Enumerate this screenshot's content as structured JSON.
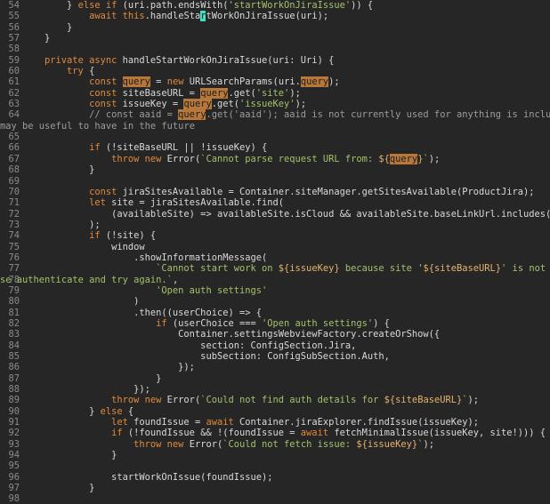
{
  "editor": {
    "language": "typescript",
    "colors": {
      "background": "#262626",
      "line_number": "#8b8b8b",
      "text": "#d9d9d9",
      "keyword": "#e08a3c",
      "string": "#a3c26a",
      "comment": "#9c9c9c",
      "search_highlight": "#b7783a",
      "cursor": "#3ce0c2"
    },
    "lines": [
      {
        "n": "54",
        "tokens": [
          {
            "t": "        } "
          },
          {
            "t": "else if",
            "c": "kw"
          },
          {
            "t": " (uri.path.endsWith("
          },
          {
            "t": "'startWorkOnJiraIssue'",
            "c": "str"
          },
          {
            "t": ")) {"
          }
        ]
      },
      {
        "n": "55",
        "tokens": [
          {
            "t": "            "
          },
          {
            "t": "await",
            "c": "kw"
          },
          {
            "t": " "
          },
          {
            "t": "this",
            "c": "kw"
          },
          {
            "t": ".handleSta"
          },
          {
            "t": "r",
            "c": "cur"
          },
          {
            "t": "tWorkOnJiraIssue(uri);"
          }
        ]
      },
      {
        "n": "56",
        "tokens": [
          {
            "t": "        }"
          }
        ]
      },
      {
        "n": "57",
        "tokens": [
          {
            "t": "    }"
          }
        ]
      },
      {
        "n": "58",
        "tokens": []
      },
      {
        "n": "59",
        "tokens": [
          {
            "t": "    "
          },
          {
            "t": "private async",
            "c": "kw"
          },
          {
            "t": " handleStartWorkOnJiraIssue(uri: Uri) {"
          }
        ]
      },
      {
        "n": "60",
        "tokens": [
          {
            "t": "        "
          },
          {
            "t": "try",
            "c": "kw"
          },
          {
            "t": " {"
          }
        ]
      },
      {
        "n": "61",
        "tokens": [
          {
            "t": "            "
          },
          {
            "t": "const",
            "c": "kw"
          },
          {
            "t": " "
          },
          {
            "t": "query",
            "c": "hl"
          },
          {
            "t": " = "
          },
          {
            "t": "new",
            "c": "kw"
          },
          {
            "t": " URLSearchParams(uri."
          },
          {
            "t": "query",
            "c": "hl"
          },
          {
            "t": ");"
          }
        ]
      },
      {
        "n": "62",
        "tokens": [
          {
            "t": "            "
          },
          {
            "t": "const",
            "c": "kw"
          },
          {
            "t": " siteBaseURL = "
          },
          {
            "t": "query",
            "c": "hl"
          },
          {
            "t": ".get("
          },
          {
            "t": "'site'",
            "c": "str"
          },
          {
            "t": ");"
          }
        ]
      },
      {
        "n": "63",
        "tokens": [
          {
            "t": "            "
          },
          {
            "t": "const",
            "c": "kw"
          },
          {
            "t": " issueKey = "
          },
          {
            "t": "query",
            "c": "hl"
          },
          {
            "t": ".get("
          },
          {
            "t": "'issueKey'",
            "c": "str"
          },
          {
            "t": ");"
          }
        ]
      },
      {
        "n": "64",
        "tokens": [
          {
            "t": "            "
          },
          {
            "t": "// const aaid = ",
            "c": "com"
          },
          {
            "t": "query",
            "c": "hl"
          },
          {
            "t": ".get('aaid'); aaid is not currently used for anything is included in the url and",
            "c": "com"
          }
        ]
      },
      {
        "n": "",
        "wrap": true,
        "tokens": [
          {
            "t": "may be useful to have in the future",
            "c": "com"
          }
        ]
      },
      {
        "n": "65",
        "tokens": []
      },
      {
        "n": "66",
        "tokens": [
          {
            "t": "            "
          },
          {
            "t": "if",
            "c": "kw"
          },
          {
            "t": " (!siteBaseURL || !issueKey) {"
          }
        ]
      },
      {
        "n": "67",
        "tokens": [
          {
            "t": "                "
          },
          {
            "t": "throw new",
            "c": "kw"
          },
          {
            "t": " Error("
          },
          {
            "t": "`Cannot parse request URL from: ",
            "c": "str"
          },
          {
            "t": "${",
            "c": "tpl"
          },
          {
            "t": "query",
            "c": "hl"
          },
          {
            "t": "}",
            "c": "tpl"
          },
          {
            "t": "`",
            "c": "str"
          },
          {
            "t": ");"
          }
        ]
      },
      {
        "n": "68",
        "tokens": [
          {
            "t": "            }"
          }
        ]
      },
      {
        "n": "69",
        "tokens": []
      },
      {
        "n": "70",
        "tokens": [
          {
            "t": "            "
          },
          {
            "t": "const",
            "c": "kw"
          },
          {
            "t": " jiraSitesAvailable = Container.siteManager.getSitesAvailable(ProductJira);"
          }
        ]
      },
      {
        "n": "71",
        "tokens": [
          {
            "t": "            "
          },
          {
            "t": "let",
            "c": "kw"
          },
          {
            "t": " site = jiraSitesAvailable.find("
          }
        ]
      },
      {
        "n": "72",
        "tokens": [
          {
            "t": "                (availableSite) => availableSite.isCloud && availableSite.baseLinkUrl.includes(siteBaseURL)"
          }
        ]
      },
      {
        "n": "73",
        "tokens": [
          {
            "t": "            );"
          }
        ]
      },
      {
        "n": "74",
        "tokens": [
          {
            "t": "            "
          },
          {
            "t": "if",
            "c": "kw"
          },
          {
            "t": " (!site) {"
          }
        ]
      },
      {
        "n": "75",
        "tokens": [
          {
            "t": "                window"
          }
        ]
      },
      {
        "n": "76",
        "tokens": [
          {
            "t": "                    .showInformationMessage("
          }
        ]
      },
      {
        "n": "77",
        "tokens": [
          {
            "t": "                        "
          },
          {
            "t": "`Cannot start work on ",
            "c": "str"
          },
          {
            "t": "${issueKey}",
            "c": "tpl"
          },
          {
            "t": " because site '",
            "c": "str"
          },
          {
            "t": "${siteBaseURL}",
            "c": "tpl"
          },
          {
            "t": "' is not authenticated. Plea",
            "c": "str"
          }
        ]
      },
      {
        "n": "78",
        "wrap": true,
        "tokens": [
          {
            "t": "se authenticate and try again.`",
            "c": "str"
          },
          {
            "t": ","
          }
        ]
      },
      {
        "n": "79",
        "tokens": [
          {
            "t": "                        "
          },
          {
            "t": "'Open auth settings'",
            "c": "str"
          }
        ]
      },
      {
        "n": "80",
        "tokens": [
          {
            "t": "                    )"
          }
        ]
      },
      {
        "n": "81",
        "tokens": [
          {
            "t": "                    .then((userChoice) => {"
          }
        ]
      },
      {
        "n": "82",
        "tokens": [
          {
            "t": "                        "
          },
          {
            "t": "if",
            "c": "kw"
          },
          {
            "t": " (userChoice === "
          },
          {
            "t": "'Open auth settings'",
            "c": "str"
          },
          {
            "t": ") {"
          }
        ]
      },
      {
        "n": "83",
        "tokens": [
          {
            "t": "                            Container.settingsWebviewFactory.createOrShow({"
          }
        ]
      },
      {
        "n": "84",
        "tokens": [
          {
            "t": "                                section: ConfigSection.Jira,"
          }
        ]
      },
      {
        "n": "85",
        "tokens": [
          {
            "t": "                                subSection: ConfigSubSection.Auth,"
          }
        ]
      },
      {
        "n": "86",
        "tokens": [
          {
            "t": "                            });"
          }
        ]
      },
      {
        "n": "87",
        "tokens": [
          {
            "t": "                        }"
          }
        ]
      },
      {
        "n": "88",
        "tokens": [
          {
            "t": "                    });"
          }
        ]
      },
      {
        "n": "89",
        "tokens": [
          {
            "t": "                "
          },
          {
            "t": "throw new",
            "c": "kw"
          },
          {
            "t": " Error("
          },
          {
            "t": "`Could not find auth details for ",
            "c": "str"
          },
          {
            "t": "${siteBaseURL}",
            "c": "tpl"
          },
          {
            "t": "`",
            "c": "str"
          },
          {
            "t": ");"
          }
        ]
      },
      {
        "n": "90",
        "tokens": [
          {
            "t": "            } "
          },
          {
            "t": "else",
            "c": "kw"
          },
          {
            "t": " {"
          }
        ]
      },
      {
        "n": "91",
        "tokens": [
          {
            "t": "                "
          },
          {
            "t": "let",
            "c": "kw"
          },
          {
            "t": " foundIssue = "
          },
          {
            "t": "await",
            "c": "kw"
          },
          {
            "t": " Container.jiraExplorer.findIssue(issueKey);"
          }
        ]
      },
      {
        "n": "92",
        "tokens": [
          {
            "t": "                "
          },
          {
            "t": "if",
            "c": "kw"
          },
          {
            "t": " (!foundIssue && !(foundIssue = "
          },
          {
            "t": "await",
            "c": "kw"
          },
          {
            "t": " fetchMinimalIssue(issueKey, site!))) {"
          }
        ]
      },
      {
        "n": "93",
        "tokens": [
          {
            "t": "                    "
          },
          {
            "t": "throw new",
            "c": "kw"
          },
          {
            "t": " Error("
          },
          {
            "t": "`Could not fetch issue: ",
            "c": "str"
          },
          {
            "t": "${issueKey}",
            "c": "tpl"
          },
          {
            "t": "`",
            "c": "str"
          },
          {
            "t": ");"
          }
        ]
      },
      {
        "n": "94",
        "tokens": [
          {
            "t": "                }"
          }
        ]
      },
      {
        "n": "95",
        "tokens": []
      },
      {
        "n": "96",
        "tokens": [
          {
            "t": "                startWorkOnIssue(foundIssue);"
          }
        ]
      },
      {
        "n": "97",
        "tokens": [
          {
            "t": "            }"
          }
        ]
      },
      {
        "n": "98",
        "tokens": []
      }
    ]
  }
}
